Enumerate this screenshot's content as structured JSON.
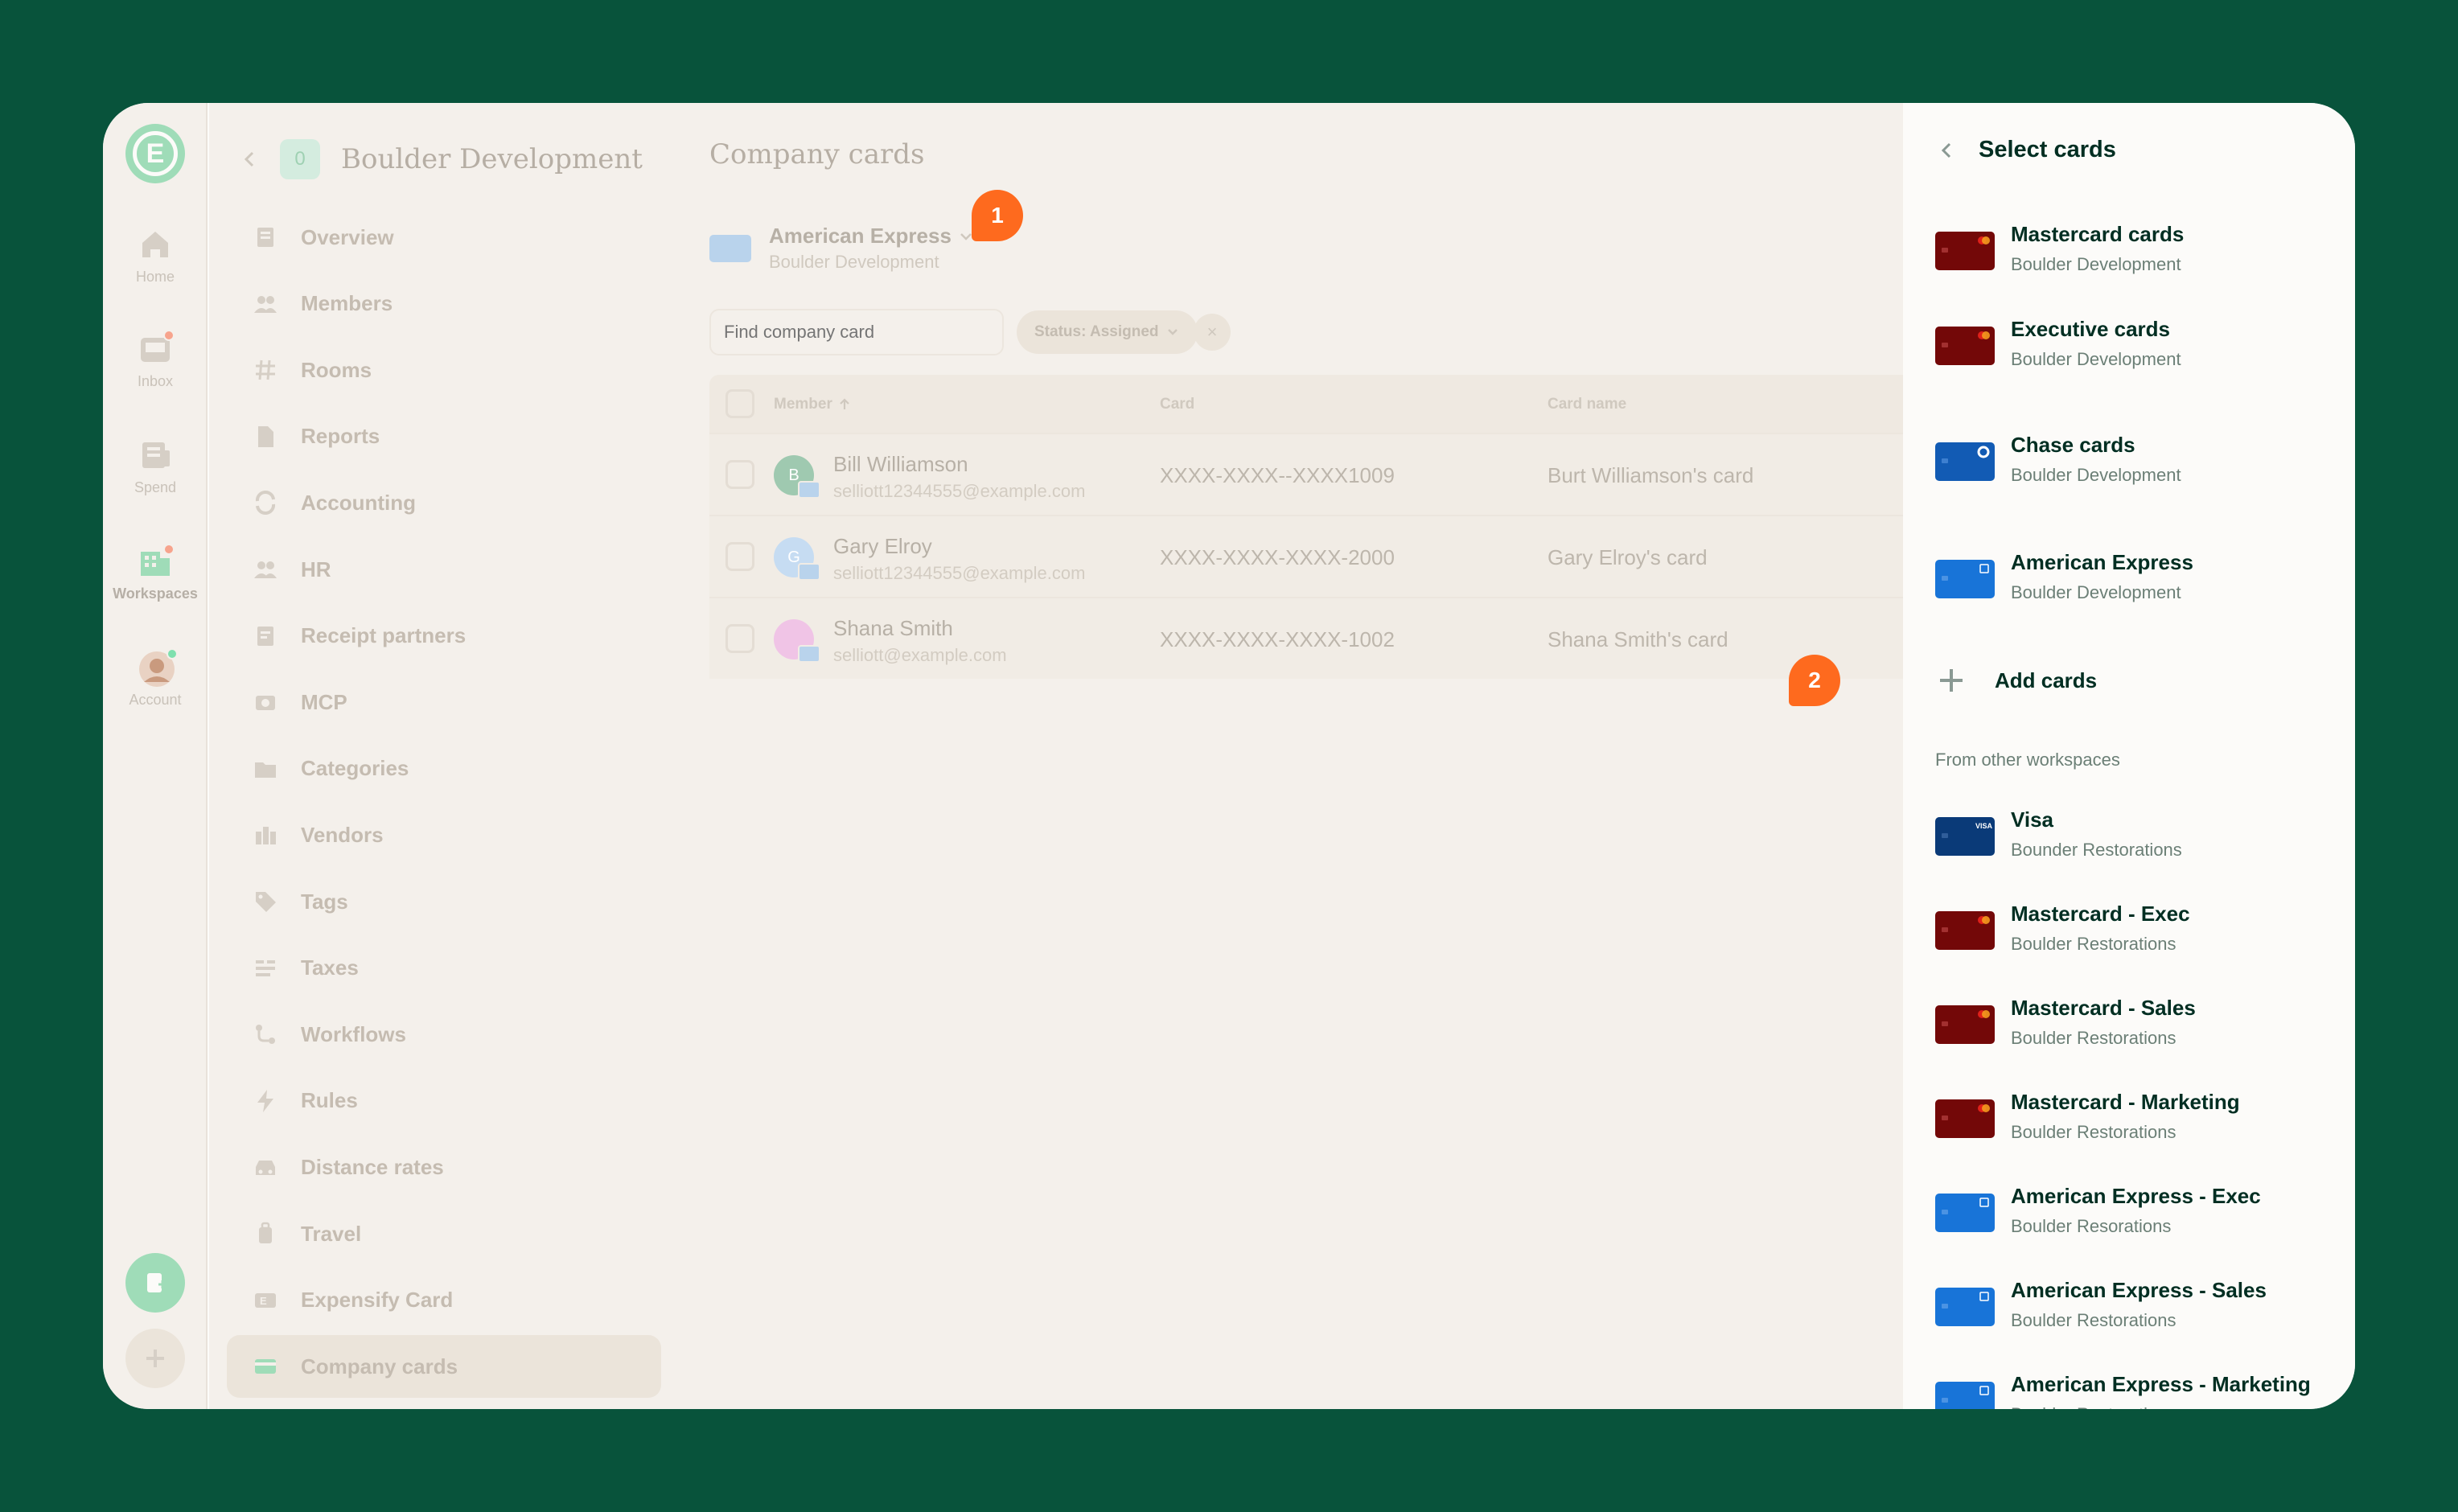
{
  "rail": {
    "home": "Home",
    "inbox": "Inbox",
    "spend": "Spend",
    "workspaces": "Workspaces",
    "account": "Account"
  },
  "nav": {
    "workspace_initial": "0",
    "workspace_name": "Boulder Development",
    "items": [
      "Overview",
      "Members",
      "Rooms",
      "Reports",
      "Accounting",
      "HR",
      "Receipt partners",
      "MCP",
      "Categories",
      "Vendors",
      "Tags",
      "Taxes",
      "Workflows",
      "Rules",
      "Distance rates",
      "Travel",
      "Expensify Card",
      "Company cards"
    ]
  },
  "main": {
    "title": "Company cards",
    "feed_name": "American Express",
    "feed_workspace": "Boulder Development",
    "search_placeholder": "Find company card",
    "status_filter": "Status: Assigned",
    "columns": {
      "member": "Member",
      "card": "Card",
      "card_name": "Card name"
    },
    "rows": [
      {
        "initial": "B",
        "name": "Bill Williamson",
        "email": "selliott12344555@example.com",
        "card": "XXXX-XXXX--XXXX1009",
        "card_name": "Burt Williamson's card"
      },
      {
        "initial": "G",
        "name": "Gary Elroy",
        "email": "selliott12344555@example.com",
        "card": "XXXX-XXXX-XXXX-2000",
        "card_name": "Gary Elroy's card"
      },
      {
        "initial": "",
        "name": "Shana Smith",
        "email": "selliott@example.com",
        "card": "XXXX-XXXX-XXXX-1002",
        "card_name": "Shana Smith's card"
      }
    ]
  },
  "panel": {
    "title": "Select cards",
    "cards": [
      {
        "name": "Mastercard cards",
        "workspace": "Boulder Development",
        "kind": "mastercard",
        "selected": false
      },
      {
        "name": "Executive cards",
        "workspace": "Boulder Development",
        "kind": "mastercard",
        "selected": false
      },
      {
        "name": "Chase cards",
        "workspace": "Boulder Development",
        "kind": "chase",
        "selected": false
      },
      {
        "name": "American Express",
        "workspace": "Boulder Development",
        "kind": "amex",
        "selected": true
      }
    ],
    "add_cards": "Add cards",
    "other_section": "From other workspaces",
    "other_cards": [
      {
        "name": "Visa",
        "workspace": "Bounder Restorations",
        "kind": "visa"
      },
      {
        "name": "Mastercard - Exec",
        "workspace": "Boulder Restorations",
        "kind": "mastercard"
      },
      {
        "name": "Mastercard - Sales",
        "workspace": "Boulder Restorations",
        "kind": "mastercard"
      },
      {
        "name": "Mastercard - Marketing",
        "workspace": "Boulder Restorations",
        "kind": "mastercard"
      },
      {
        "name": "American Express - Exec",
        "workspace": "Boulder Resorations",
        "kind": "amex"
      },
      {
        "name": "American Express - Sales",
        "workspace": "Boulder Restorations",
        "kind": "amex"
      },
      {
        "name": "American Express  - Marketing",
        "workspace": "Boulder Restorations",
        "kind": "amex"
      }
    ]
  },
  "callouts": {
    "one": "1",
    "two": "2"
  },
  "colors": {
    "background": "#08533b",
    "accent_green": "#03d47c",
    "callout_orange": "#fe6a1e",
    "mastercard_red": "#7d0a0a",
    "amex_blue": "#1874d8",
    "chase_blue": "#125bb4",
    "visa_navy": "#0a3a78"
  }
}
